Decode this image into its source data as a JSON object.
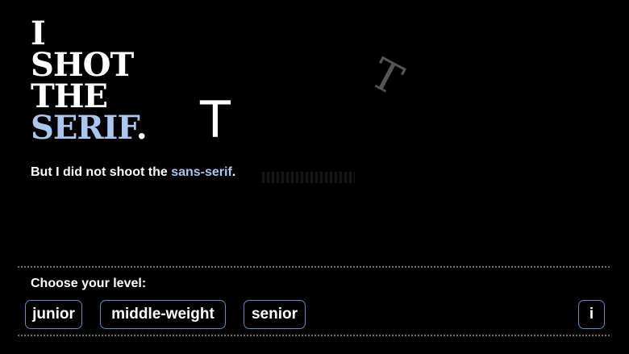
{
  "title": {
    "line1": "I",
    "line2": "SHOT",
    "line3": "THE",
    "line4_accent": "SERIF",
    "line4_end": "."
  },
  "letters": {
    "sans_letter": "T",
    "serif_letter": "T"
  },
  "subtitle": {
    "prefix": "But I did not shoot the ",
    "accent": "sans-serif",
    "suffix": "."
  },
  "level": {
    "label": "Choose your level:",
    "options": [
      "junior",
      "middle-weight",
      "senior"
    ],
    "info_label": "i"
  },
  "colors": {
    "background": "#000000",
    "text": "#ffffff",
    "accent": "#a8c8f0",
    "button_border": "#5b8cc8",
    "divider": "#6e6e6e",
    "serif_letter": "#555555"
  }
}
